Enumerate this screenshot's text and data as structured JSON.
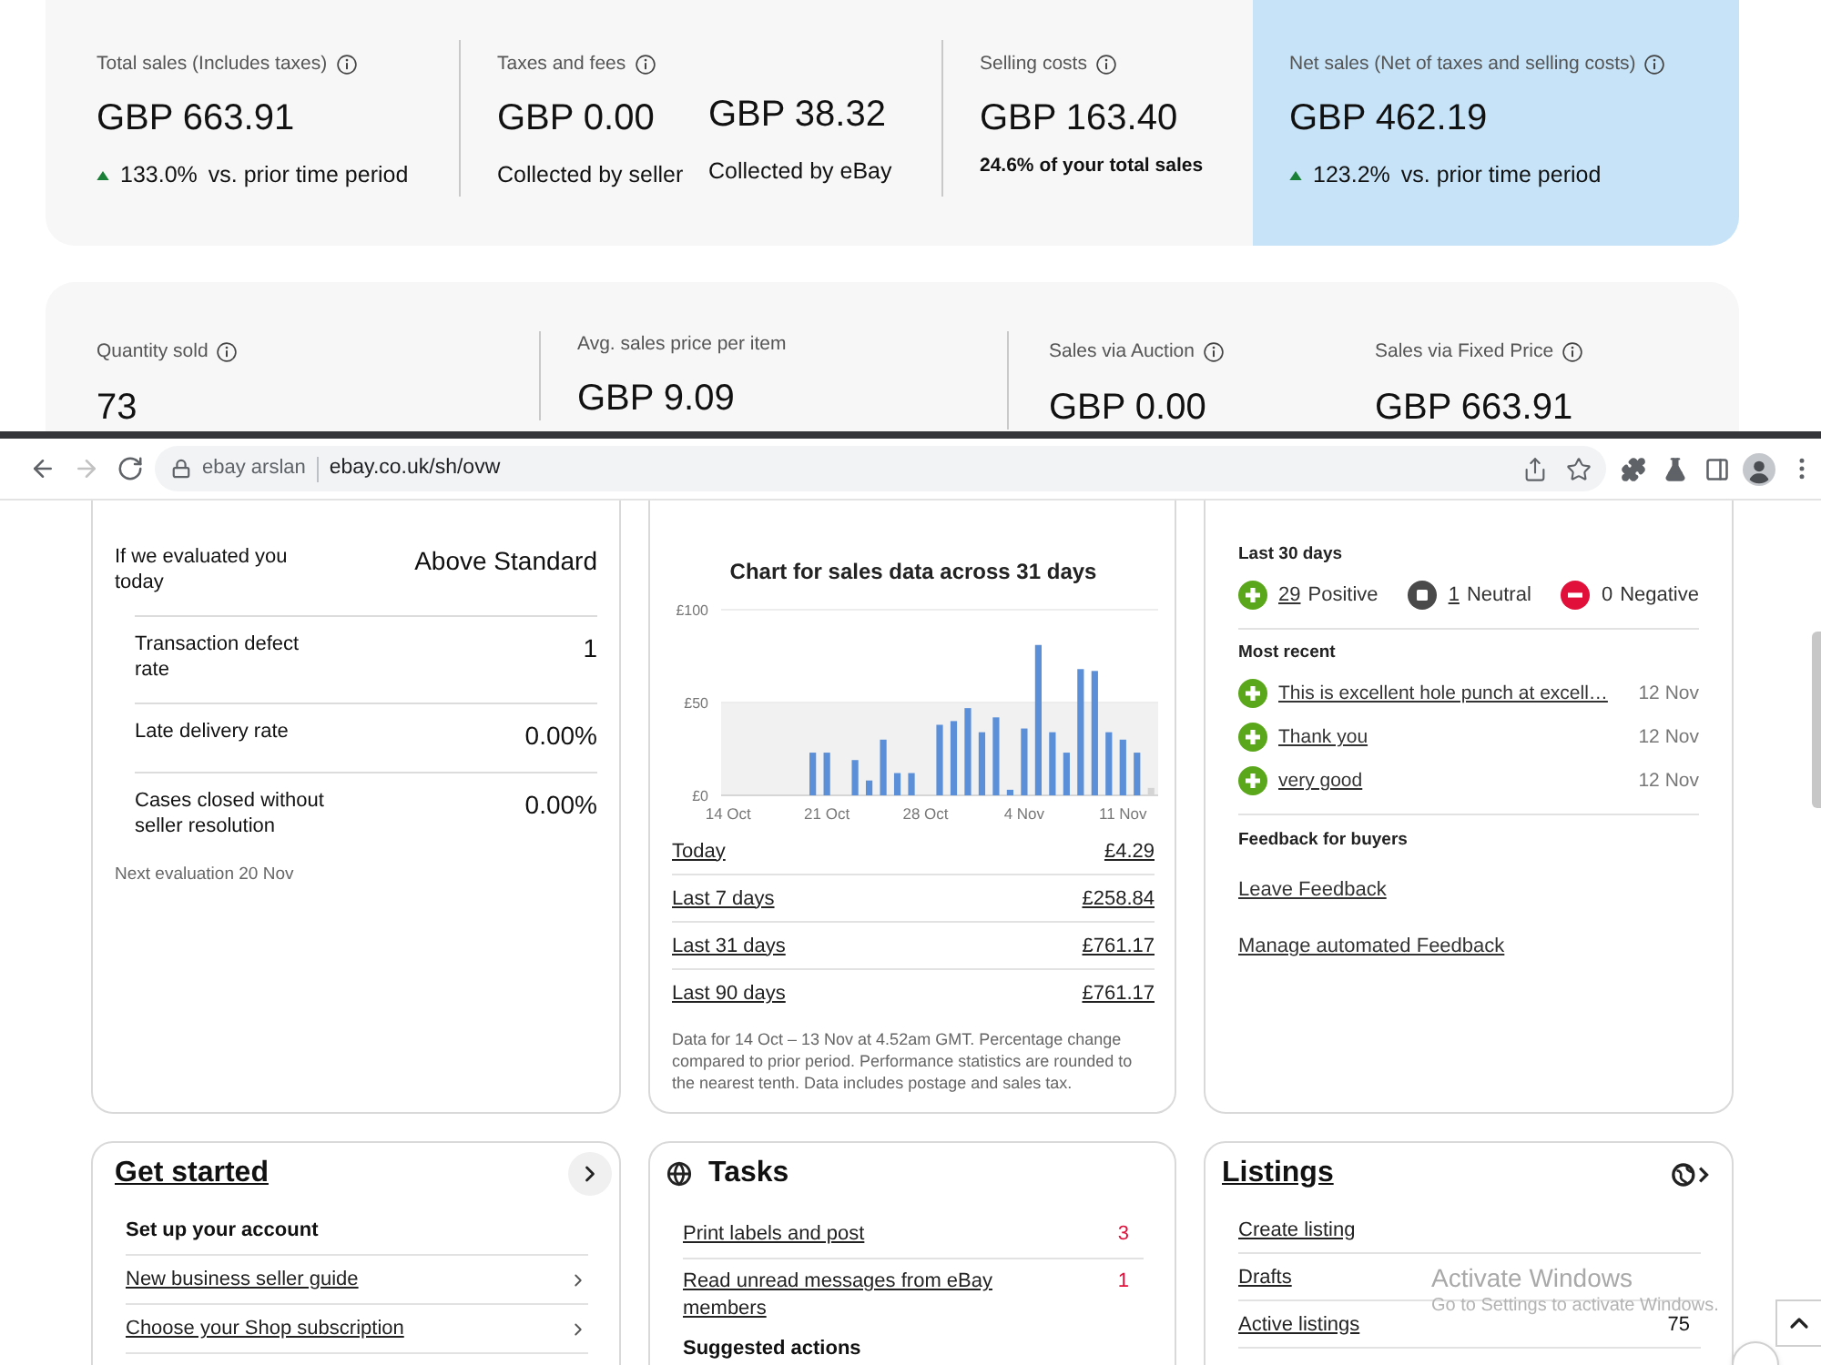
{
  "top_summary": {
    "metrics": [
      {
        "kind": "change",
        "label": "Total sales (Includes taxes)",
        "info": true,
        "highlighted": false,
        "value": "GBP 663.91",
        "rising": true,
        "change": "133.0%",
        "comparison": "vs. prior time period"
      },
      {
        "kind": "split",
        "label": "Taxes and fees",
        "info": true,
        "highlighted": false,
        "parts": [
          {
            "value": "GBP 0.00",
            "caption": "Collected by seller"
          },
          {
            "value": "GBP 38.32",
            "caption": "Collected by eBay"
          }
        ]
      },
      {
        "kind": "share",
        "label": "Selling costs",
        "info": true,
        "highlighted": false,
        "value": "GBP 163.40",
        "note": "24.6% of your total sales"
      },
      {
        "kind": "change",
        "label": "Net sales (Net of taxes and selling costs)",
        "info": true,
        "highlighted": true,
        "value": "GBP 462.19",
        "rising": true,
        "change": "123.2%",
        "comparison": "vs. prior time period"
      }
    ]
  },
  "sales_breakdown": {
    "metrics": [
      {
        "label": "Quantity sold",
        "info": true,
        "value": "73"
      },
      {
        "label": "Avg. sales price per item",
        "info": false,
        "value": "GBP 9.09"
      },
      {
        "label": "Sales via Auction",
        "info": true,
        "value": "GBP 0.00"
      },
      {
        "label": "Sales via Fixed Price",
        "info": true,
        "value": "GBP 663.91"
      }
    ]
  },
  "browser": {
    "nav": [
      {
        "kind": "back",
        "disabled": false
      },
      {
        "kind": "forward",
        "disabled": true
      },
      {
        "kind": "reload",
        "disabled": false
      }
    ],
    "site_name": "ebay arslan",
    "url": "ebay.co.uk/sh/ovw"
  },
  "seller_level": {
    "evaluation_label": "If we evaluated you today",
    "evaluation_value": "Above Standard",
    "metrics": [
      {
        "label": "Transaction defect rate",
        "value": "1"
      },
      {
        "label": "Late delivery rate",
        "value": "0.00%"
      },
      {
        "label": "Cases closed without seller resolution",
        "value": "0.00%"
      }
    ],
    "next_evaluation": "Next evaluation 20 Nov"
  },
  "sales": {
    "chart_data": {
      "type": "bar",
      "title": "Chart for sales data across 31 days",
      "categories": [
        "14 Oct",
        null,
        null,
        null,
        null,
        null,
        null,
        "21 Oct",
        null,
        null,
        null,
        null,
        null,
        null,
        "28 Oct",
        null,
        null,
        null,
        null,
        null,
        null,
        "4 Nov",
        null,
        null,
        null,
        null,
        null,
        null,
        "11 Nov",
        null,
        null
      ],
      "series": [
        {
          "color": "#5b8fd8",
          "values": [
            0,
            0,
            0,
            0,
            0,
            0,
            23,
            23,
            0,
            19,
            8,
            30,
            12,
            12,
            0,
            38,
            40,
            47,
            34,
            42,
            3,
            36,
            81,
            34,
            23,
            68,
            67,
            34,
            30,
            23,
            null
          ]
        },
        {
          "color": "#d4d4d4",
          "values": [
            null,
            null,
            null,
            null,
            null,
            null,
            null,
            null,
            null,
            null,
            null,
            null,
            null,
            null,
            null,
            null,
            null,
            null,
            null,
            null,
            null,
            null,
            null,
            null,
            null,
            null,
            null,
            null,
            null,
            null,
            4
          ]
        }
      ],
      "ylim": [
        0,
        100
      ],
      "yticks": [
        {
          "value": 0,
          "label": "£0"
        },
        {
          "value": 50,
          "label": "£50"
        },
        {
          "value": 100,
          "label": "£100"
        }
      ],
      "bands": [
        {
          "axis": "y",
          "from": 0,
          "to": 50
        }
      ]
    },
    "periods": [
      {
        "label": "Today",
        "amount": "£4.29"
      },
      {
        "label": "Last 7 days",
        "amount": "£258.84"
      },
      {
        "label": "Last 31 days",
        "amount": "£761.17"
      },
      {
        "label": "Last 90 days",
        "amount": "£761.17"
      }
    ],
    "note": "Data for 14 Oct – 13 Nov at 4.52am GMT. Percentage change compared to prior period. Performance statistics are rounded to the nearest tenth. Data includes postage and sales tax."
  },
  "feedback": {
    "summary_heading": "Last 30 days",
    "counts": [
      {
        "kind": "positive",
        "count": "29",
        "label": "Positive",
        "link": true
      },
      {
        "kind": "neutral",
        "count": "1",
        "label": "Neutral",
        "link": true
      },
      {
        "kind": "negative",
        "count": "0",
        "label": "Negative",
        "link": false
      }
    ],
    "recent_heading": "Most recent",
    "recent": [
      {
        "kind": "positive",
        "text": "This is excellent hole punch at excell…",
        "date": "12 Nov"
      },
      {
        "kind": "positive",
        "text": "Thank you",
        "date": "12 Nov"
      },
      {
        "kind": "positive",
        "text": "very good",
        "date": "12 Nov"
      }
    ],
    "buyers_heading": "Feedback for buyers",
    "links": [
      "Leave Feedback",
      "Manage automated Feedback"
    ]
  },
  "get_started": {
    "title": "Get started",
    "section": "Set up your account",
    "items": [
      "New business seller guide",
      "Choose your Shop subscription"
    ]
  },
  "tasks": {
    "title": "Tasks",
    "items": [
      {
        "text": "Print labels and post",
        "count": "3"
      },
      {
        "text": "Read unread messages from eBay members",
        "count": "1"
      }
    ],
    "section": "Suggested actions"
  },
  "listings": {
    "title": "Listings",
    "items": [
      {
        "text": "Create listing"
      },
      {
        "text": "Drafts"
      },
      {
        "text": "Active listings",
        "count": "75"
      }
    ]
  },
  "os_notice": {
    "title": "Activate Windows",
    "text": "Go to Settings to activate Windows."
  }
}
